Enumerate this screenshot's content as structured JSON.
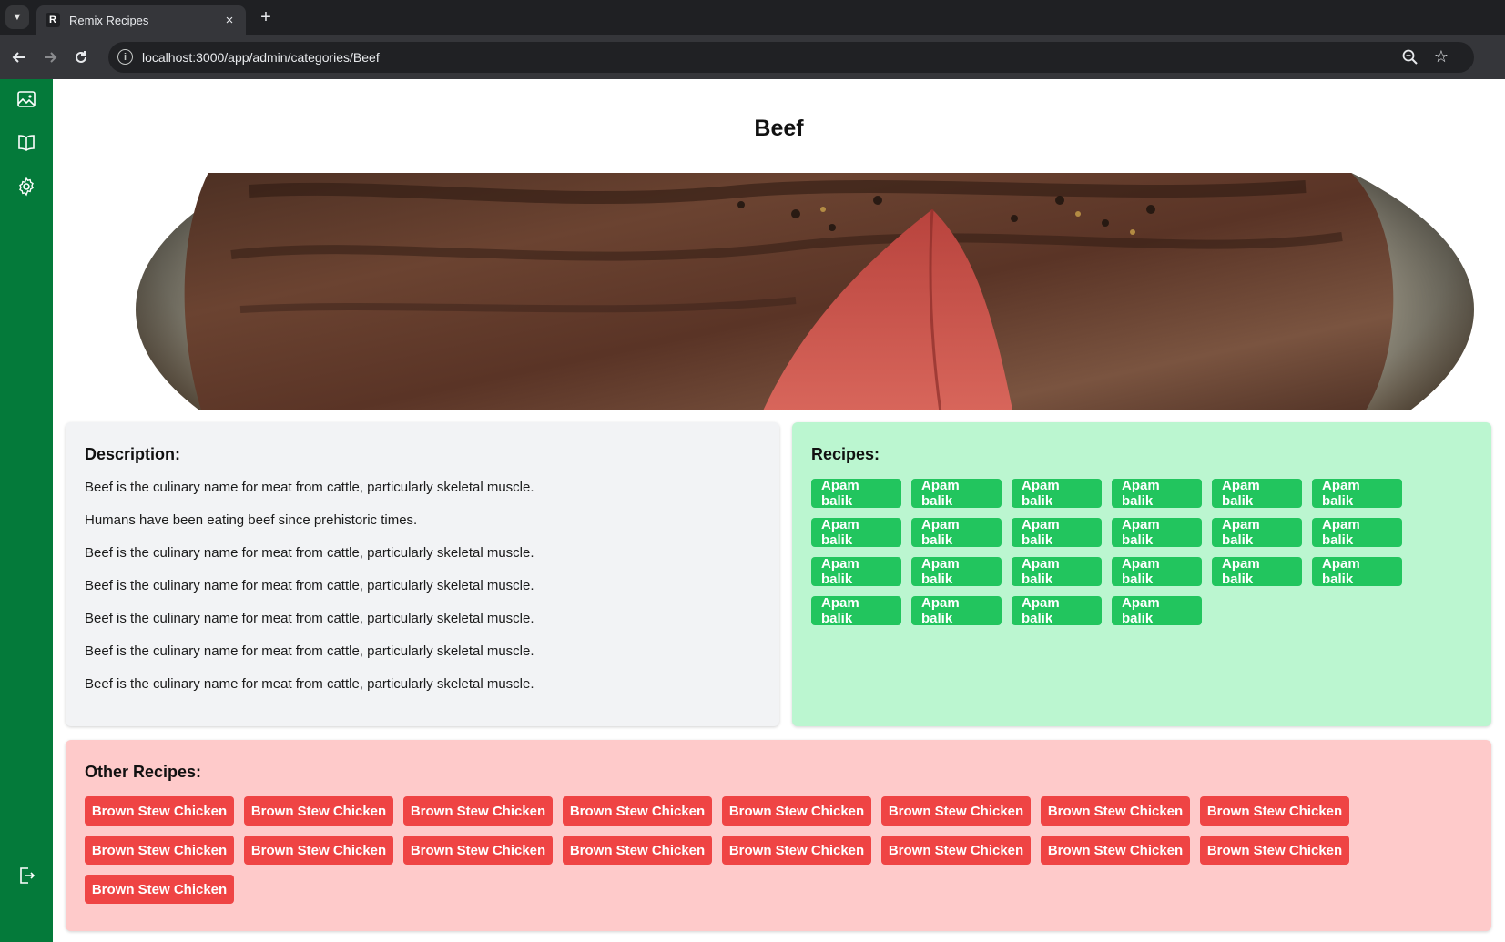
{
  "browser": {
    "tab_title": "Remix Recipes",
    "tab_favicon": "R",
    "url": "localhost:3000/app/admin/categories/Beef",
    "new_tab_label": "+",
    "tab_close_label": "×"
  },
  "sidebar": {
    "items": [
      {
        "icon": "image-icon"
      },
      {
        "icon": "book-icon"
      },
      {
        "icon": "gear-icon"
      }
    ],
    "logout_icon": "logout-icon",
    "color": "#047a3a"
  },
  "page": {
    "title": "Beef"
  },
  "description": {
    "heading": "Description:",
    "lines": [
      "Beef is the culinary name for meat from cattle, particularly skeletal muscle.",
      "Humans have been eating beef since prehistoric times.",
      "Beef is the culinary name for meat from cattle, particularly skeletal muscle.",
      "Beef is the culinary name for meat from cattle, particularly skeletal muscle.",
      "Beef is the culinary name for meat from cattle, particularly skeletal muscle.",
      "Beef is the culinary name for meat from cattle, particularly skeletal muscle.",
      "Beef is the culinary name for meat from cattle, particularly skeletal muscle."
    ]
  },
  "recipes": {
    "heading": "Recipes:",
    "items": [
      "Apam balik",
      "Apam balik",
      "Apam balik",
      "Apam balik",
      "Apam balik",
      "Apam balik",
      "Apam balik",
      "Apam balik",
      "Apam balik",
      "Apam balik",
      "Apam balik",
      "Apam balik",
      "Apam balik",
      "Apam balik",
      "Apam balik",
      "Apam balik",
      "Apam balik",
      "Apam balik",
      "Apam balik",
      "Apam balik",
      "Apam balik",
      "Apam balik"
    ]
  },
  "other_recipes": {
    "heading": "Other Recipes:",
    "items": [
      "Brown Stew Chicken",
      "Brown Stew Chicken",
      "Brown Stew Chicken",
      "Brown Stew Chicken",
      "Brown Stew Chicken",
      "Brown Stew Chicken",
      "Brown Stew Chicken",
      "Brown Stew Chicken",
      "Brown Stew Chicken",
      "Brown Stew Chicken",
      "Brown Stew Chicken",
      "Brown Stew Chicken",
      "Brown Stew Chicken",
      "Brown Stew Chicken",
      "Brown Stew Chicken",
      "Brown Stew Chicken",
      "Brown Stew Chicken"
    ]
  },
  "colors": {
    "recipe_chip": "#22c55e",
    "other_chip": "#ef4444",
    "recipes_card_bg": "#bbf6d0",
    "other_card_bg": "#fecaca",
    "description_card_bg": "#f2f3f5"
  }
}
